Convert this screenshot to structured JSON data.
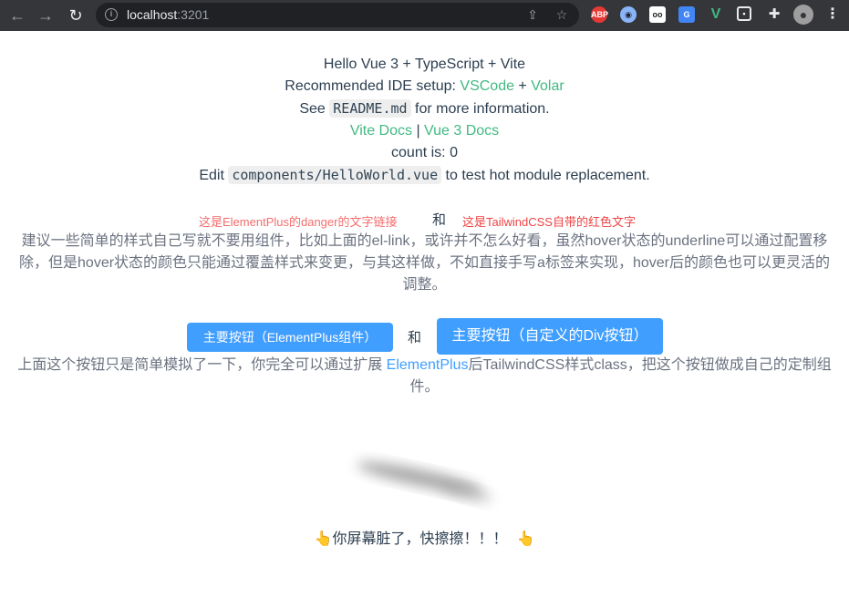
{
  "browser": {
    "url_host": "localhost",
    "url_port": ":3201",
    "extensions": [
      "abp-icon",
      "vpn-icon",
      "mask-icon",
      "translate-icon",
      "vue-devtools-icon",
      "screenshot-icon",
      "puzzle-icon",
      "profile-avatar",
      "menu-icon"
    ],
    "abp_label": "ABP"
  },
  "hello": {
    "title": "Hello Vue 3 + TypeScript + Vite",
    "ide_prefix": "Recommended IDE setup: ",
    "ide_link1": "VSCode",
    "ide_plus": " + ",
    "ide_link2": "Volar",
    "see_prefix": "See ",
    "readme": "README.md",
    "see_suffix": " for more information.",
    "vite_docs": "Vite Docs",
    "sep": " | ",
    "vue_docs": "Vue 3 Docs",
    "count_label": "count is: 0",
    "edit_prefix": "Edit ",
    "edit_file": "components/HelloWorld.vue",
    "edit_suffix": " to test hot module replacement."
  },
  "links_demo": {
    "ep_danger_link": "这是ElementPlus的danger的文字链接",
    "and": "和",
    "tw_red_text": "这是TailwindCSS自带的红色文字",
    "paragraph": "建议一些简单的样式自己写就不要用组件，比如上面的el-link，或许并不怎么好看，虽然hover状态的underline可以通过配置移除，但是hover状态的颜色只能通过覆盖样式来变更，与其这样做，不如直接手写a标签来实现，hover后的颜色也可以更灵活的调整。"
  },
  "buttons_demo": {
    "ep_button": "主要按钮（ElementPlus组件）",
    "and": "和",
    "div_button": "主要按钮（自定义的Div按钮）",
    "para_prefix": "上面这个按钮只是简单模拟了一下，你完全可以通过扩展 ",
    "para_link": "ElementPlus",
    "para_suffix": "后TailwindCSS样式class，把这个按钮做成自己的定制组件。"
  },
  "dirty_screen": {
    "left_emoji": "👆",
    "text": "你屏幕脏了，快擦擦！！！",
    "right_emoji": "👆"
  },
  "colors": {
    "vue_green": "#42b983",
    "element_primary": "#409eff",
    "element_danger": "#f56c6c",
    "tailwind_red": "#ef4444",
    "text": "#2c3e50",
    "gray_text": "#6b7280"
  }
}
